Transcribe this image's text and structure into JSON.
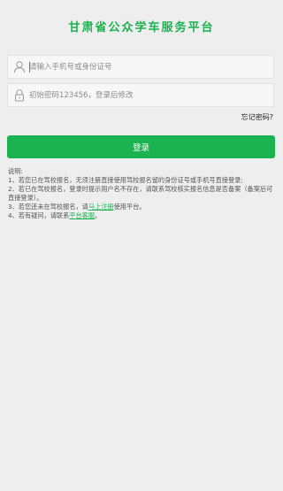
{
  "header": {
    "title": "甘肃省公众学车服务平台"
  },
  "form": {
    "username": {
      "value": "",
      "placeholder": "请输入手机号或身份证号",
      "icon": "user-icon"
    },
    "password": {
      "value": "",
      "placeholder": "初始密码123456，登录后修改",
      "icon": "lock-icon"
    },
    "forgot_label": "忘记密码?",
    "login_label": "登录"
  },
  "notes": {
    "heading": "说明:",
    "item1": "1、若您已在驾校报名，无须注册直接使用驾校报名留的身份证号或手机号直接登录;",
    "item2": "2、若已在驾校报名，登录时提示用户名不存在，请联系驾校核实报名信息是否备案（备案后可直接登录）。",
    "item3_before": "3、若您还未在驾校报名，请",
    "item3_link": "马上注册",
    "item3_after": "使用平台。",
    "item4_before": "4、若有疑问，请联系",
    "item4_link": "平台客服",
    "item4_after": "。"
  },
  "colors": {
    "accent": "#1ab350",
    "background": "#eeeeee"
  }
}
